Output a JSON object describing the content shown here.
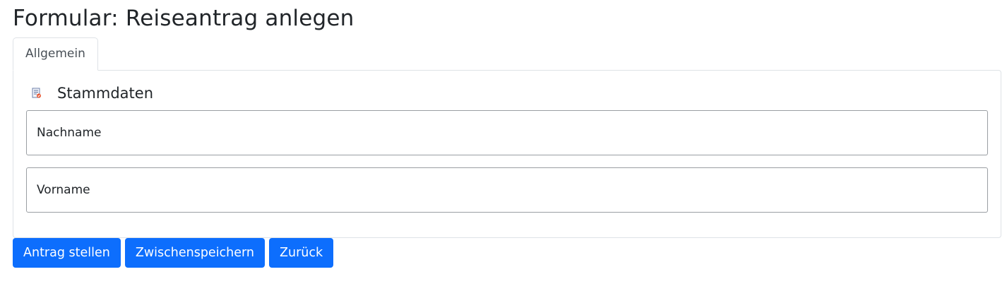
{
  "header": {
    "title": "Formular: Reiseantrag anlegen"
  },
  "tabs": [
    {
      "label": "Allgemein",
      "active": true
    }
  ],
  "section": {
    "icon": "form-edit-icon",
    "title": "Stammdaten"
  },
  "fields": [
    {
      "label": "Nachname",
      "value": ""
    },
    {
      "label": "Vorname",
      "value": ""
    }
  ],
  "actions": {
    "submit_label": "Antrag stellen",
    "save_label": "Zwischenspeichern",
    "back_label": "Zurück"
  },
  "colors": {
    "primary": "#0d6efd",
    "text": "#212529",
    "border": "#dee2e6"
  }
}
